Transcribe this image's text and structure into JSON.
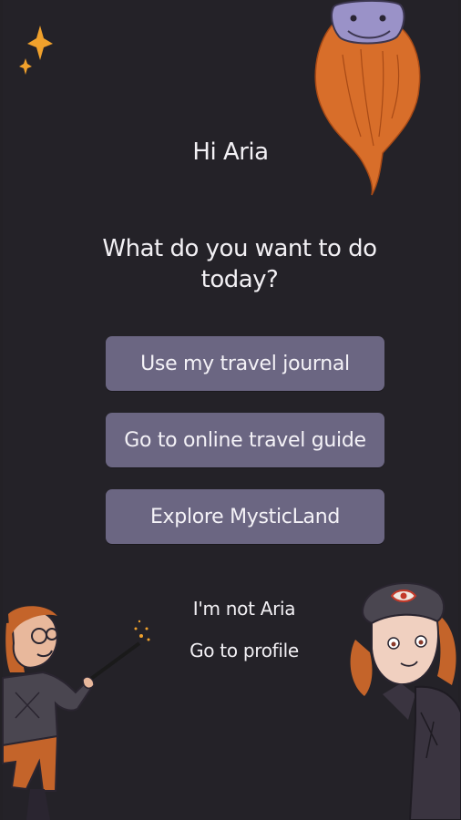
{
  "greeting": "Hi Aria",
  "question": "What do you want to do today?",
  "actions": [
    {
      "label": "Use my travel journal"
    },
    {
      "label": "Go to online travel guide"
    },
    {
      "label": "Explore MysticLand"
    }
  ],
  "links": {
    "not_user": "I'm not Aria",
    "profile": "Go to profile"
  },
  "colors": {
    "background": "#242228",
    "button": "#6b6682",
    "sparkle": "#f0a12c",
    "beard": "#d86e2a"
  }
}
